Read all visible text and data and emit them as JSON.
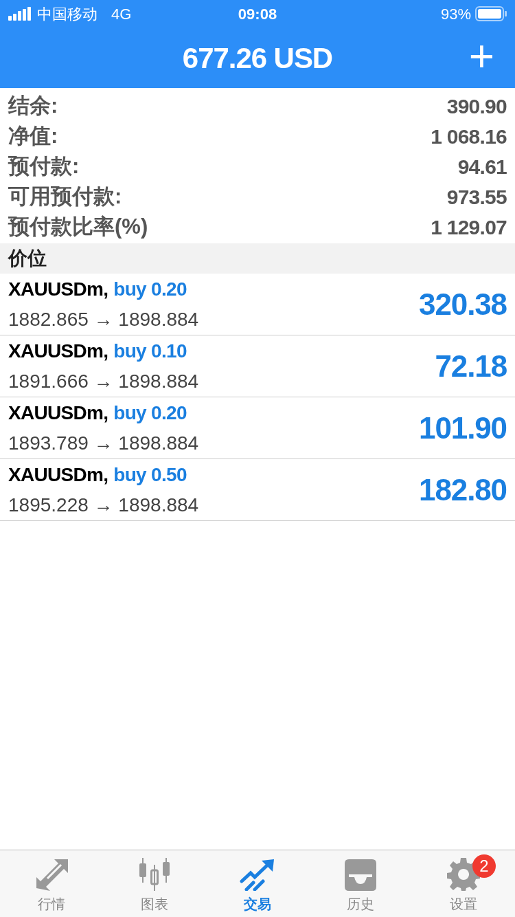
{
  "status_bar": {
    "carrier": "中国移动",
    "network": "4G",
    "time": "09:08",
    "battery": "93%"
  },
  "header": {
    "title": "677.26 USD",
    "add_button": "+"
  },
  "summary": [
    {
      "label": "结余:",
      "value": "390.90"
    },
    {
      "label": "净值:",
      "value": "1 068.16"
    },
    {
      "label": "预付款:",
      "value": "94.61"
    },
    {
      "label": "可用预付款:",
      "value": "973.55"
    },
    {
      "label": "预付款比率(%)",
      "value": "1 129.07"
    }
  ],
  "section_title": "价位",
  "positions": [
    {
      "symbol": "XAUUSDm,",
      "order": "buy 0.20",
      "prices": "1882.865 → 1898.884",
      "profit": "320.38"
    },
    {
      "symbol": "XAUUSDm,",
      "order": "buy 0.10",
      "prices": "1891.666 → 1898.884",
      "profit": "72.18"
    },
    {
      "symbol": "XAUUSDm,",
      "order": "buy 0.20",
      "prices": "1893.789 → 1898.884",
      "profit": "101.90"
    },
    {
      "symbol": "XAUUSDm,",
      "order": "buy 0.50",
      "prices": "1895.228 → 1898.884",
      "profit": "182.80"
    }
  ],
  "tabs": [
    {
      "kind": "quotes",
      "label": "行情",
      "selected": false
    },
    {
      "kind": "chart",
      "label": "图表",
      "selected": false
    },
    {
      "kind": "trade",
      "label": "交易",
      "selected": true
    },
    {
      "kind": "history",
      "label": "历史",
      "selected": false
    },
    {
      "kind": "settings",
      "label": "设置",
      "selected": false,
      "badge": "2"
    }
  ]
}
